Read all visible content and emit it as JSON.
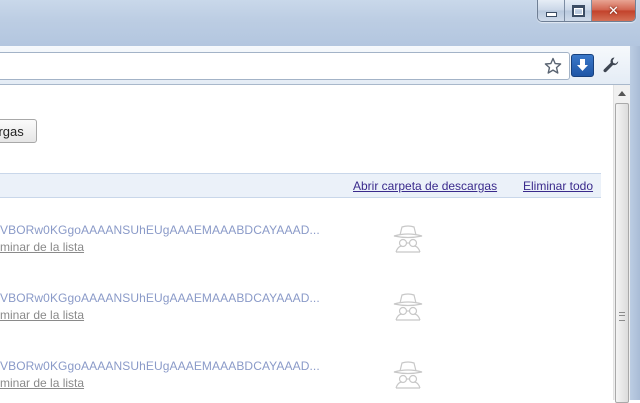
{
  "window": {
    "controls": {
      "minimize_icon": "minimize-icon",
      "maximize_icon": "maximize-icon",
      "close_icon": "close-icon",
      "close_glyph": "✕"
    }
  },
  "toolbar": {
    "address_value": "",
    "star_icon": "star-icon",
    "download_icon": "download-icon",
    "wrench_icon": "wrench-icon"
  },
  "page": {
    "clear_button_label": "escargas",
    "header_links": {
      "open_folder": "Abrir carpeta de descargas",
      "clear_all": "Eliminar todo"
    },
    "items": [
      {
        "name": "VBORw0KGgoAAAANSUhEUgAAAEMAAABDCAYAAAD...",
        "remove": "minar de la lista",
        "icon": "incognito-icon"
      },
      {
        "name": "VBORw0KGgoAAAANSUhEUgAAAEMAAABDCAYAAAD...",
        "remove": "minar de la lista",
        "icon": "incognito-icon"
      },
      {
        "name": "VBORw0KGgoAAAANSUhEUgAAAEMAAABDCAYAAAD...",
        "remove": "minar de la lista",
        "icon": "incognito-icon"
      }
    ]
  },
  "colors": {
    "link": "#3a2a8c",
    "item_name": "#8a9ac8",
    "header_bg": "#ebf1f9",
    "frame": "#bccde3"
  }
}
